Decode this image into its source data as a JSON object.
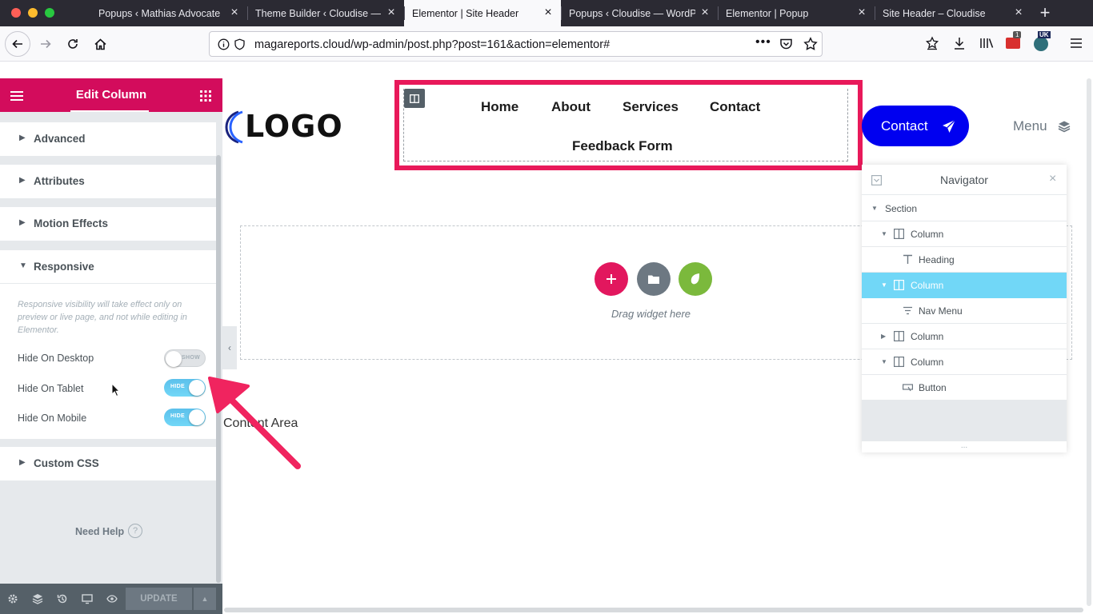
{
  "browser": {
    "tabs": [
      {
        "title": "Popups ‹ Mathias Advocate",
        "active": false
      },
      {
        "title": "Theme Builder ‹ Cloudise —",
        "active": false
      },
      {
        "title": "Elementor | Site Header",
        "active": true
      },
      {
        "title": "Popups ‹ Cloudise — WordP",
        "active": false
      },
      {
        "title": "Elementor | Popup",
        "active": false
      },
      {
        "title": "Site Header – Cloudise",
        "active": false
      }
    ],
    "url": "magareports.cloud/wp-admin/post.php?post=161&action=elementor#",
    "badge_count": "1",
    "badge_region": "UK"
  },
  "panel": {
    "title": "Edit Column",
    "sections": {
      "advanced": "Advanced",
      "attributes": "Attributes",
      "motion": "Motion Effects",
      "responsive": "Responsive",
      "custom_css": "Custom CSS"
    },
    "responsive_note": "Responsive visibility will take effect only on preview or live page, and not while editing in Elementor.",
    "controls": {
      "desktop": {
        "label": "Hide On Desktop",
        "state": "SHOW"
      },
      "tablet": {
        "label": "Hide On Tablet",
        "state": "HIDE"
      },
      "mobile": {
        "label": "Hide On Mobile",
        "state": "HIDE"
      }
    },
    "need_help": "Need Help",
    "help_icon": "?",
    "update": "UPDATE"
  },
  "canvas": {
    "logo": "LOGO",
    "menu": {
      "home": "Home",
      "about": "About",
      "services": "Services",
      "contact": "Contact",
      "feedback": "Feedback Form"
    },
    "contact_button": "Contact",
    "menu_toggle": "Menu",
    "drop_hint": "Drag widget here",
    "content_area": "Content Area"
  },
  "navigator": {
    "title": "Navigator",
    "items": [
      {
        "label": "Section"
      },
      {
        "label": "Column"
      },
      {
        "label": "Heading"
      },
      {
        "label": "Column"
      },
      {
        "label": "Nav Menu"
      },
      {
        "label": "Column"
      },
      {
        "label": "Column"
      },
      {
        "label": "Button"
      }
    ],
    "grip": "..."
  },
  "colors": {
    "elementor_pink": "#d30c5c",
    "highlight_frame": "#e8195a",
    "switch_on": "#71d7f7",
    "contact_blue": "#0000f0",
    "add_button": "#e2175e",
    "template_button": "#6d7882",
    "envato_button": "#7bb93c"
  }
}
